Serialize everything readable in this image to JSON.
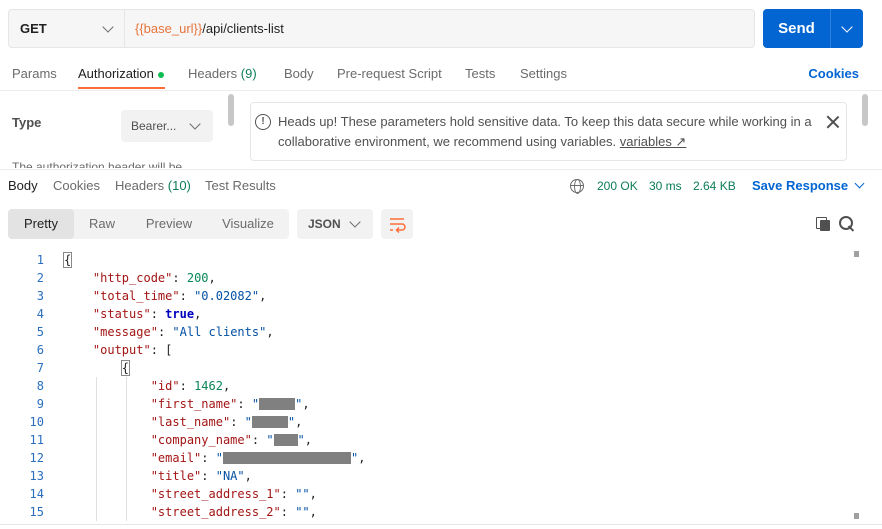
{
  "request": {
    "method": "GET",
    "url_var": "{{base_url}}",
    "url_path": "/api/clients-list",
    "send_label": "Send"
  },
  "req_tabs": {
    "params": "Params",
    "authorization": "Authorization",
    "headers": "Headers",
    "headers_count": "(9)",
    "body": "Body",
    "prerequest": "Pre-request Script",
    "tests": "Tests",
    "settings": "Settings",
    "cookies": "Cookies"
  },
  "auth": {
    "type_label": "Type",
    "type_value": "Bearer...",
    "help_text": "The authorization header will be",
    "warning_text": "Heads up! These parameters hold sensitive data. To keep this data secure while working in a collaborative environment, we recommend using variables.",
    "warning_link": "variables ↗"
  },
  "resp_tabs": {
    "body": "Body",
    "cookies": "Cookies",
    "headers": "Headers",
    "headers_count": "(10)",
    "test_results": "Test Results",
    "status": "200 OK",
    "time": "30 ms",
    "size": "2.64 KB",
    "save_response": "Save Response"
  },
  "viewer": {
    "modes": [
      "Pretty",
      "Raw",
      "Preview",
      "Visualize"
    ],
    "active_mode": "Pretty",
    "format": "JSON"
  },
  "code": {
    "line_numbers": [
      "1",
      "2",
      "3",
      "4",
      "5",
      "6",
      "7",
      "8",
      "9",
      "10",
      "11",
      "12",
      "13",
      "14",
      "15"
    ],
    "http_code_key": "\"http_code\"",
    "http_code_val": "200",
    "total_time_key": "\"total_time\"",
    "total_time_val": "\"0.02082\"",
    "status_key": "\"status\"",
    "status_val": "true",
    "message_key": "\"message\"",
    "message_val": "\"All clients\"",
    "output_key": "\"output\"",
    "id_key": "\"id\"",
    "id_val": "1462",
    "first_name_key": "\"first_name\"",
    "last_name_key": "\"last_name\"",
    "company_name_key": "\"company_name\"",
    "email_key": "\"email\"",
    "title_key": "\"title\"",
    "title_val": "\"NA\"",
    "street1_key": "\"street_address_1\"",
    "street1_val": "\"\"",
    "street2_key": "\"street_address_2\"",
    "street2_val": "\"\""
  },
  "colors": {
    "accent": "#0265d2",
    "tab_active": "#ff6c37",
    "status_ok": "#0c7c59",
    "url_variable": "#e8743b"
  }
}
